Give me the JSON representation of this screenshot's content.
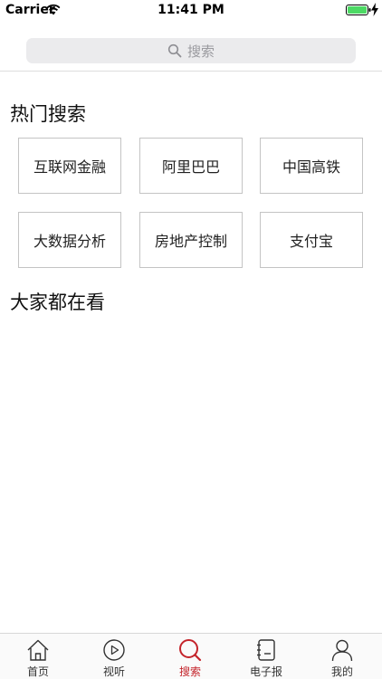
{
  "status_bar": {
    "carrier": "Carrier",
    "time": "11:41 PM"
  },
  "search": {
    "placeholder": "搜索"
  },
  "hot_search": {
    "title": "热门搜索",
    "tags": [
      "互联网金融",
      "阿里巴巴",
      "中国高铁",
      "大数据分析",
      "房地产控制",
      "支付宝"
    ]
  },
  "everyone_watching": {
    "title": "大家都在看"
  },
  "tab_bar": {
    "active": "search",
    "tabs": [
      {
        "id": "home",
        "label": "首页",
        "icon": "home-icon"
      },
      {
        "id": "video",
        "label": "视听",
        "icon": "play-circle-icon"
      },
      {
        "id": "search",
        "label": "搜索",
        "icon": "search-icon"
      },
      {
        "id": "epaper",
        "label": "电子报",
        "icon": "notebook-icon"
      },
      {
        "id": "profile",
        "label": "我的",
        "icon": "person-icon"
      }
    ]
  },
  "colors": {
    "accent": "#c4242b",
    "battery": "#4cd964",
    "tag_border": "#c4c4c4",
    "search_bg": "#ebebed"
  }
}
